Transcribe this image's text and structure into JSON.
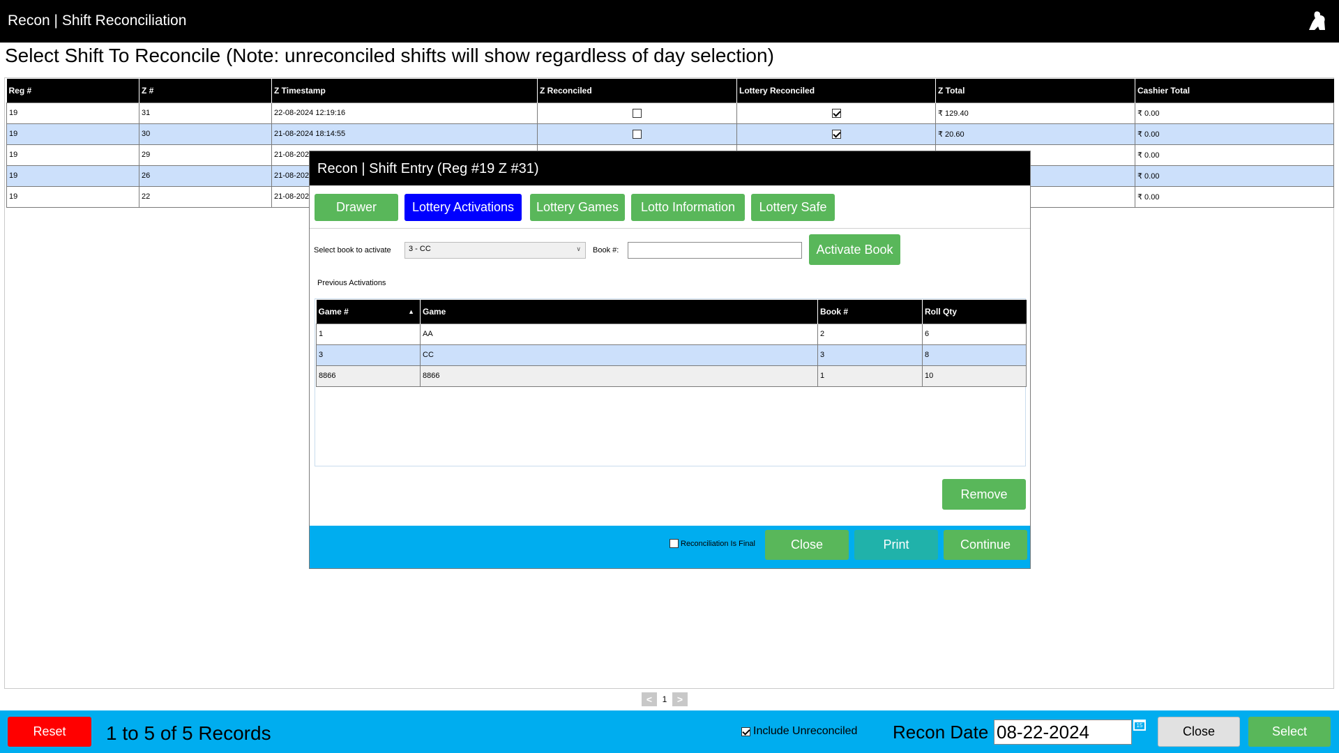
{
  "window": {
    "title": "Recon | Shift Reconciliation",
    "logo_icon": "app-logo-icon"
  },
  "heading": "Select Shift To Reconcile (Note: unreconciled shifts will show regardless of day selection)",
  "grid": {
    "columns": [
      "Reg #",
      "Z #",
      "Z Timestamp",
      "Z Reconciled",
      "Lottery Reconciled",
      "Z Total",
      "Cashier Total"
    ],
    "rows": [
      {
        "reg": "19",
        "z": "31",
        "ts": "22-08-2024 12:19:16",
        "z_rec": false,
        "lot_rec": true,
        "z_total": "₹ 129.40",
        "cashier_total": "₹ 0.00"
      },
      {
        "reg": "19",
        "z": "30",
        "ts": "21-08-2024 18:14:55",
        "z_rec": false,
        "lot_rec": true,
        "z_total": "₹ 20.60",
        "cashier_total": "₹ 0.00"
      },
      {
        "reg": "19",
        "z": "29",
        "ts": "21-08-202",
        "z_rec": null,
        "lot_rec": null,
        "z_total": "",
        "cashier_total": "₹ 0.00"
      },
      {
        "reg": "19",
        "z": "26",
        "ts": "21-08-202",
        "z_rec": null,
        "lot_rec": null,
        "z_total": "",
        "cashier_total": "₹ 0.00"
      },
      {
        "reg": "19",
        "z": "22",
        "ts": "21-08-202",
        "z_rec": null,
        "lot_rec": null,
        "z_total": "",
        "cashier_total": "₹ 0.00"
      }
    ]
  },
  "pager": {
    "prev": "<",
    "page": "1",
    "next": ">"
  },
  "footer": {
    "reset_label": "Reset",
    "records_text": "1 to 5 of 5 Records",
    "include_unreconciled_label": "Include Unreconciled",
    "include_unreconciled_checked": true,
    "recon_date_label": "Recon Date :",
    "recon_date_value": "08-22-2024",
    "calendar_day": "15",
    "close_label": "Close",
    "select_label": "Select"
  },
  "modal": {
    "title": "Recon | Shift Entry  (Reg #19  Z #31)",
    "tabs": [
      {
        "label": "Drawer",
        "active": false
      },
      {
        "label": "Lottery Activations",
        "active": true
      },
      {
        "label": "Lottery Games",
        "active": false
      },
      {
        "label": "Lotto Information",
        "active": false
      },
      {
        "label": "Lottery Safe",
        "active": false
      }
    ],
    "select_book_label": "Select book to activate",
    "select_book_value": "3 - CC",
    "book_num_label": "Book #:",
    "book_num_value": "",
    "activate_label": "Activate Book",
    "previous_label": "Previous Activations",
    "sub_columns": [
      "Game #",
      "Game",
      "Book #",
      "Roll Qty"
    ],
    "sub_rows": [
      {
        "game_num": "1",
        "game": "AA",
        "book": "2",
        "qty": "6"
      },
      {
        "game_num": "3",
        "game": "CC",
        "book": "3",
        "qty": "8"
      },
      {
        "game_num": "8866",
        "game": "8866",
        "book": "1",
        "qty": "10"
      }
    ],
    "remove_label": "Remove",
    "final_label": "Reconciliation Is Final",
    "final_checked": false,
    "close_label": "Close",
    "print_label": "Print",
    "continue_label": "Continue"
  },
  "colors": {
    "accent_blue": "#00adef",
    "green": "#59b75a",
    "red": "#ff0000",
    "active_tab": "#0000ff",
    "row_alt": "#cce0fb",
    "teal": "#20b2aa"
  }
}
